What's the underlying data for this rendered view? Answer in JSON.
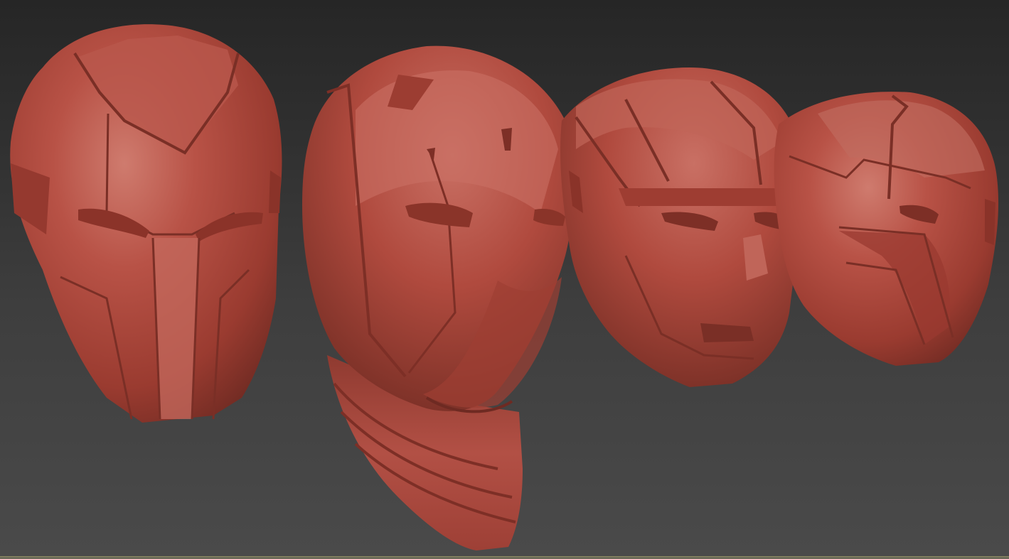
{
  "scene": {
    "background": "#303030",
    "material_color": "#b04a3e",
    "highlight_color": "#c9786c",
    "shadow_color": "#6e2a22",
    "objects": [
      {
        "name": "helmet-front-view"
      },
      {
        "name": "helmet-three-quarter-view"
      },
      {
        "name": "helmet-side-angle-view"
      },
      {
        "name": "helmet-profile-view"
      }
    ]
  },
  "status_bar": {
    "accent": "#8e8b63"
  }
}
